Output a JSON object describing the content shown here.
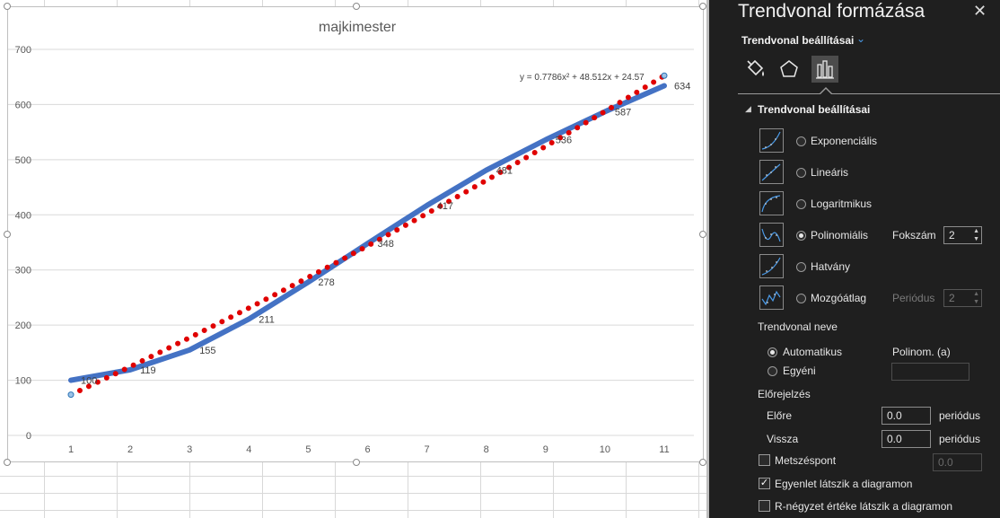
{
  "chart_data": {
    "type": "line",
    "title": "majkimester",
    "x": [
      1,
      2,
      3,
      4,
      5,
      6,
      7,
      8,
      9,
      10,
      11
    ],
    "series": [
      {
        "values": [
          100,
          119,
          155,
          211,
          278,
          348,
          417,
          481,
          536,
          587,
          634
        ],
        "color": "#4472c4",
        "style": "solid"
      }
    ],
    "data_labels": [
      "100",
      "119",
      "155",
      "211",
      "278",
      "348",
      "417",
      "481",
      "536",
      "587",
      "634"
    ],
    "trendline": {
      "type": "polynomial",
      "order": 2,
      "coefficients": {
        "a": 0.7786,
        "b": 48.512,
        "c": 24.57
      },
      "equation_label": "y = 0.7786x² + 48.512x + 24.57",
      "color": "#e00000",
      "style": "round-dot"
    },
    "ylim": [
      0,
      700
    ],
    "xlim": [
      1,
      11
    ],
    "yticks": [
      "0",
      "100",
      "200",
      "300",
      "400",
      "500",
      "600",
      "700"
    ],
    "xticks": [
      "1",
      "2",
      "3",
      "4",
      "5",
      "6",
      "7",
      "8",
      "9",
      "10",
      "11"
    ],
    "grid": true,
    "legend": "none"
  },
  "pane": {
    "title": "Trendvonal formázása",
    "close_icon": "close-icon",
    "subtitle": "Trendvonal beállításai",
    "tabs": [
      {
        "icon": "fill-line-icon",
        "active": false
      },
      {
        "icon": "effects-pentagon-icon",
        "active": false
      },
      {
        "icon": "bar-chart-options-icon",
        "active": true
      }
    ],
    "section": "Trendvonal beállításai",
    "types": [
      {
        "label": "Exponenciális",
        "selected": false
      },
      {
        "label": "Lineáris",
        "selected": false
      },
      {
        "label": "Logaritmikus",
        "selected": false
      },
      {
        "label": "Polinomiális",
        "selected": true
      },
      {
        "label": "Hatvány",
        "selected": false
      },
      {
        "label": "Mozgóátlag",
        "selected": false
      }
    ],
    "order_label": "Fokszám",
    "order_value": "2",
    "period_label": "Periódus",
    "period_value": "2",
    "name_heading": "Trendvonal neve",
    "name_auto": "Automatikus",
    "name_auto_value": "Polinom. (a)",
    "name_custom": "Egyéni",
    "name_custom_value": "",
    "forecast_heading": "Előrejelzés",
    "forward_label": "Előre",
    "forward_value": "0.0",
    "backward_label": "Vissza",
    "backward_value": "0.0",
    "unit": "periódus",
    "intercept_label": "Metszéspont",
    "intercept_value": "0.0",
    "intercept_checked": false,
    "show_equation_label": "Egyenlet látszik a diagramon",
    "show_equation_checked": true,
    "show_r2_label": "R-négyzet értéke látszik a diagramon",
    "show_r2_checked": false
  }
}
